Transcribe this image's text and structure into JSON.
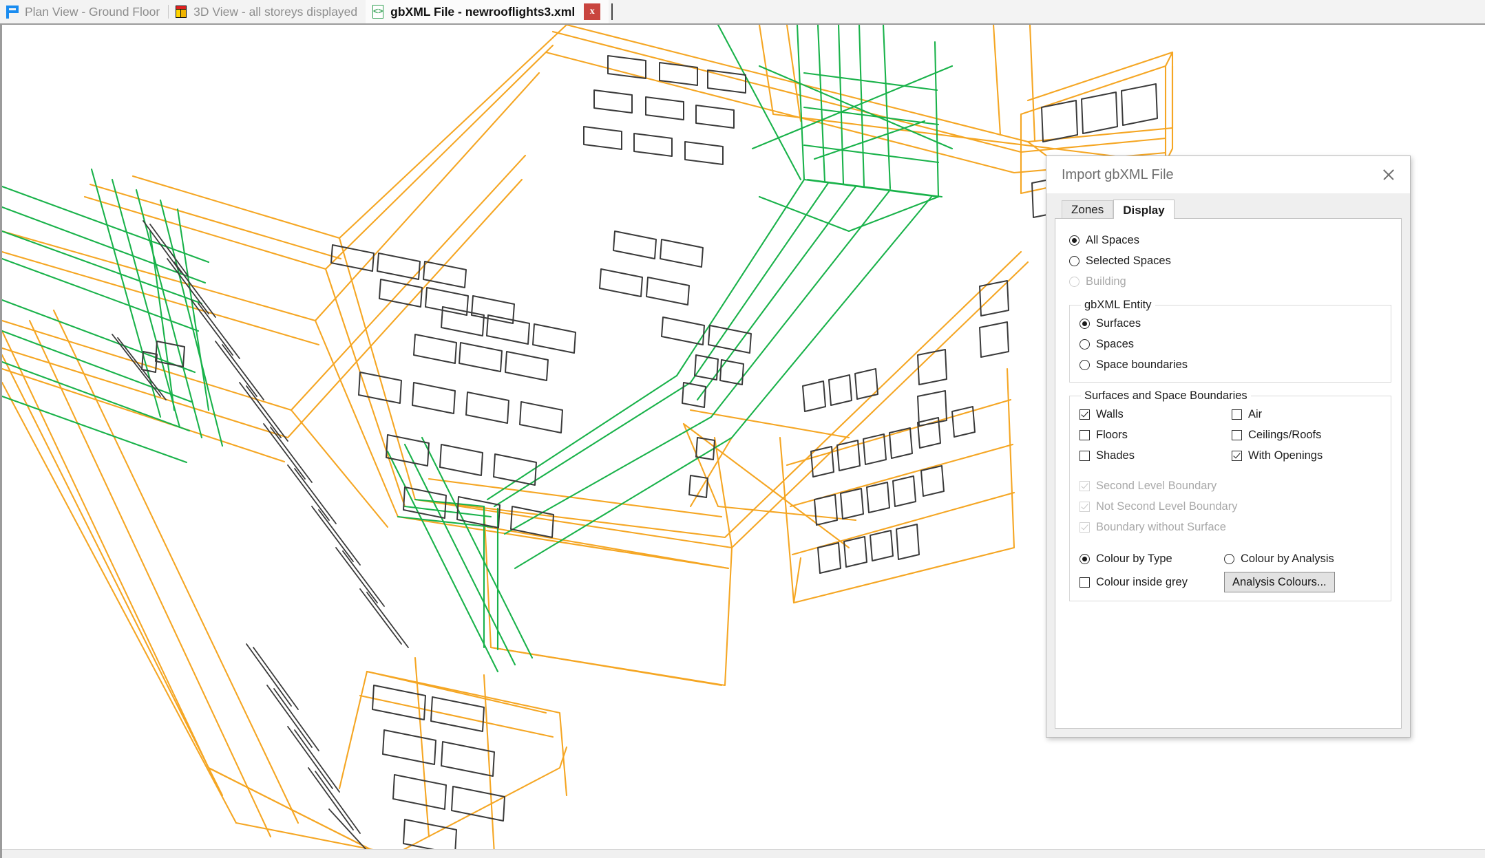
{
  "window": {
    "tabs": [
      {
        "id": "plan-view",
        "label": "Plan View - Ground Floor",
        "icon": "plan-view-icon",
        "active": false,
        "closable": false
      },
      {
        "id": "three-d-view",
        "label": "3D View - all storeys displayed",
        "icon": "cube-icon",
        "active": false,
        "closable": false
      },
      {
        "id": "gbxml-file",
        "label": "gbXML File - newrooflights3.xml",
        "icon": "xml-document-icon",
        "active": true,
        "closable": true,
        "close_label": "x"
      }
    ]
  },
  "canvas": {
    "name": "3d-model-viewport",
    "colors": {
      "surface_orange": "#F5A623",
      "space_boundary_green": "#19B24A",
      "opening_dark": "#3A3A3A",
      "background": "#FFFFFF"
    }
  },
  "dialog": {
    "title": "Import gbXML File",
    "close_icon": "close-icon",
    "tabs": [
      {
        "id": "zones",
        "label": "Zones",
        "active": false
      },
      {
        "id": "display",
        "label": "Display",
        "active": true
      }
    ],
    "scope": {
      "options": [
        {
          "id": "all-spaces",
          "label": "All Spaces",
          "checked": true,
          "disabled": false
        },
        {
          "id": "selected-spaces",
          "label": "Selected Spaces",
          "checked": false,
          "disabled": false
        },
        {
          "id": "building",
          "label": "Building",
          "checked": false,
          "disabled": true
        }
      ]
    },
    "entity": {
      "legend": "gbXML Entity",
      "options": [
        {
          "id": "surfaces",
          "label": "Surfaces",
          "checked": true,
          "disabled": false
        },
        {
          "id": "spaces",
          "label": "Spaces",
          "checked": false,
          "disabled": false
        },
        {
          "id": "space-boundaries",
          "label": "Space boundaries",
          "checked": false,
          "disabled": false
        }
      ]
    },
    "surfaces_group": {
      "legend": "Surfaces and Space Boundaries",
      "left_column": [
        {
          "id": "walls",
          "label": "Walls",
          "checked": true,
          "disabled": false
        },
        {
          "id": "floors",
          "label": "Floors",
          "checked": false,
          "disabled": false
        },
        {
          "id": "shades",
          "label": "Shades",
          "checked": false,
          "disabled": false
        }
      ],
      "right_column": [
        {
          "id": "air",
          "label": "Air",
          "checked": false,
          "disabled": false
        },
        {
          "id": "ceilings-roofs",
          "label": "Ceilings/Roofs",
          "checked": false,
          "disabled": false
        },
        {
          "id": "with-openings",
          "label": "With Openings",
          "checked": true,
          "disabled": false
        }
      ],
      "boundary_options": [
        {
          "id": "second-level-boundary",
          "label": "Second Level Boundary",
          "checked": true,
          "disabled": true
        },
        {
          "id": "not-second-level-boundary",
          "label": "Not Second Level Boundary",
          "checked": true,
          "disabled": true
        },
        {
          "id": "boundary-without-surface",
          "label": "Boundary without Surface",
          "checked": true,
          "disabled": true
        }
      ],
      "colour_mode": [
        {
          "id": "colour-by-type",
          "label": "Colour by Type",
          "checked": true,
          "disabled": false
        },
        {
          "id": "colour-by-analysis",
          "label": "Colour by Analysis",
          "checked": false,
          "disabled": false
        }
      ],
      "colour_inside_grey": {
        "id": "colour-inside-grey",
        "label": "Colour inside grey",
        "checked": false,
        "disabled": false
      },
      "analysis_colours_button": "Analysis Colours..."
    }
  }
}
